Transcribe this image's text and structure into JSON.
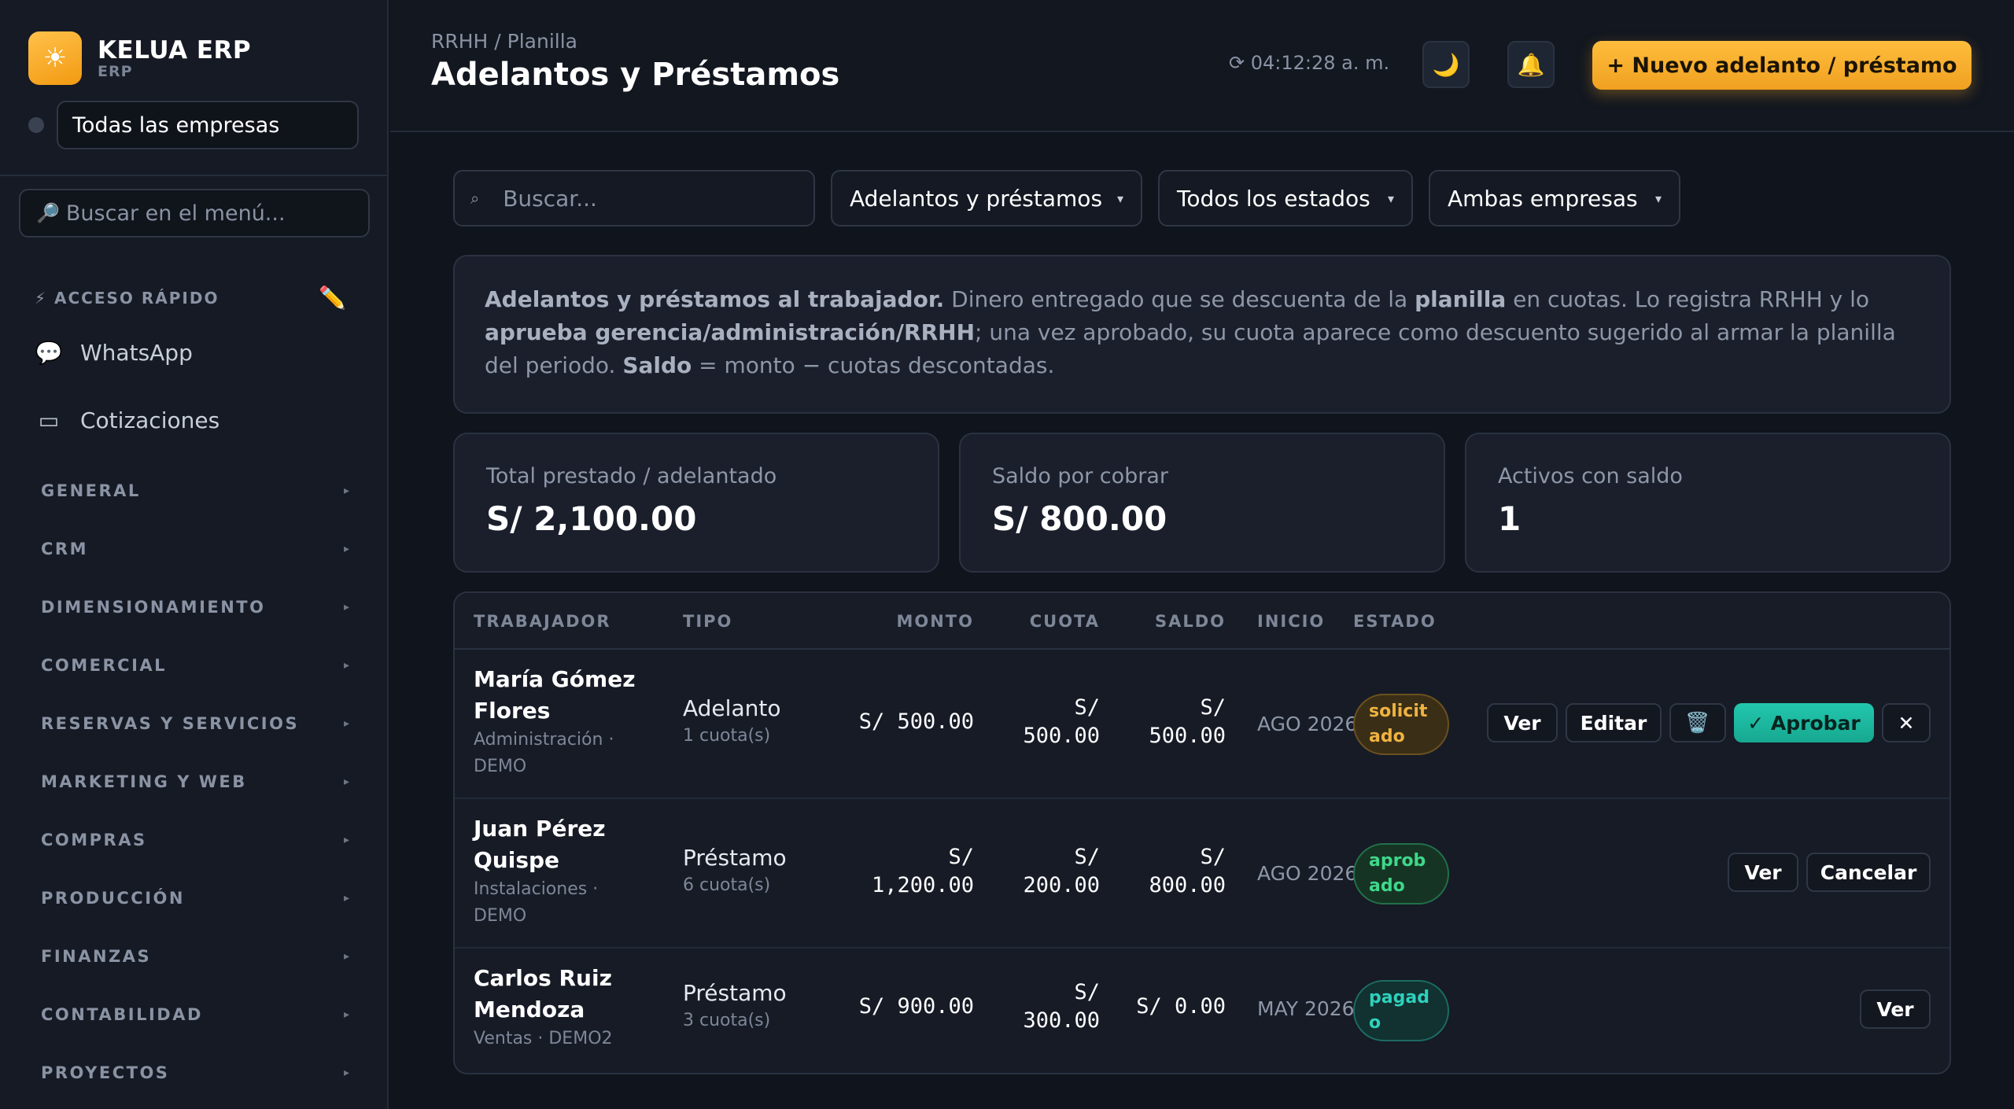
{
  "brand": {
    "name": "KELUA ERP",
    "sub": "ERP",
    "logo_icon": "☀"
  },
  "company_selector": {
    "value": "Todas las empresas"
  },
  "menu_search": {
    "placeholder": "Buscar en el menú...",
    "icon": "🔎"
  },
  "quick_access": {
    "title": "⚡ ACCESO RÁPIDO",
    "edit_icon": "✏️",
    "items": [
      {
        "label": "WhatsApp",
        "icon": "💬"
      },
      {
        "label": "Cotizaciones",
        "icon": "▭"
      }
    ]
  },
  "sections": [
    "GENERAL",
    "CRM",
    "DIMENSIONAMIENTO",
    "COMERCIAL",
    "RESERVAS Y SERVICIOS",
    "MARKETING Y WEB",
    "COMPRAS",
    "PRODUCCIÓN",
    "FINANZAS",
    "CONTABILIDAD",
    "PROYECTOS"
  ],
  "section_chevron": "▸",
  "header": {
    "breadcrumb": "RRHH / Planilla",
    "title": "Adelantos y Préstamos",
    "clock": "⟳ 04:12:28 a. m.",
    "theme_icon": "🌙",
    "bell_icon": "🔔",
    "new_button": "+ Nuevo adelanto / préstamo"
  },
  "filters": {
    "search_placeholder": "Buscar...",
    "search_icon": "⌕",
    "type": "Adelantos y préstamos",
    "status": "Todos los estados",
    "company": "Ambas empresas",
    "caret": "▾"
  },
  "info": {
    "b1": "Adelantos y préstamos al trabajador.",
    "t1": " Dinero entregado que se descuenta de la ",
    "b2": "planilla",
    "t2": " en cuotas. Lo registra RRHH y lo ",
    "b3": "aprueba gerencia/administración/RRHH",
    "t3": "; una vez aprobado, su cuota aparece como descuento sugerido al armar la planilla del periodo. ",
    "b4": "Saldo",
    "t4": " = monto − cuotas descontadas."
  },
  "stats": [
    {
      "label": "Total prestado / adelantado",
      "value": "S/ 2,100.00"
    },
    {
      "label": "Saldo por cobrar",
      "value": "S/ 800.00"
    },
    {
      "label": "Activos con saldo",
      "value": "1"
    }
  ],
  "table": {
    "headers": {
      "worker": "TRABAJADOR",
      "type": "TIPO",
      "amount": "MONTO",
      "installment": "CUOTA",
      "balance": "SALDO",
      "start": "INICIO",
      "status": "ESTADO"
    },
    "rows": [
      {
        "name_1": "María Gómez",
        "name_2": "Flores",
        "sub_1": "Administración ·",
        "sub_2": "DEMO",
        "type": "Adelanto",
        "cuotas": "1 cuota(s)",
        "amount_1": "S/ 500.00",
        "amount_2": "",
        "cuota_1": "S/",
        "cuota_2": "500.00",
        "saldo_1": "S/",
        "saldo_2": "500.00",
        "start": "AGO 2026",
        "status_1": "solicit",
        "status_2": "ado",
        "actions": {
          "view": "Ver",
          "edit": "Editar",
          "delete_icon": "🗑️",
          "approve": "✓ Aprobar",
          "reject": "✕"
        }
      },
      {
        "name_1": "Juan Pérez",
        "name_2": "Quispe",
        "sub_1": "Instalaciones ·",
        "sub_2": "DEMO",
        "type": "Préstamo",
        "cuotas": "6 cuota(s)",
        "amount_1": "S/",
        "amount_2": "1,200.00",
        "cuota_1": "S/",
        "cuota_2": "200.00",
        "saldo_1": "S/",
        "saldo_2": "800.00",
        "start": "AGO 2026",
        "status_1": "aprob",
        "status_2": "ado",
        "actions": {
          "view": "Ver",
          "cancel": "Cancelar"
        }
      },
      {
        "name_1": "Carlos Ruiz",
        "name_2": "Mendoza",
        "sub_1": "Ventas · DEMO2",
        "sub_2": "",
        "type": "Préstamo",
        "cuotas": "3 cuota(s)",
        "amount_1": "S/ 900.00",
        "amount_2": "",
        "cuota_1": "S/",
        "cuota_2": "300.00",
        "saldo_1": "S/ 0.00",
        "saldo_2": "",
        "start": "MAY 2026",
        "status_1": "pagad",
        "status_2": "o",
        "actions": {
          "view": "Ver"
        }
      }
    ]
  }
}
